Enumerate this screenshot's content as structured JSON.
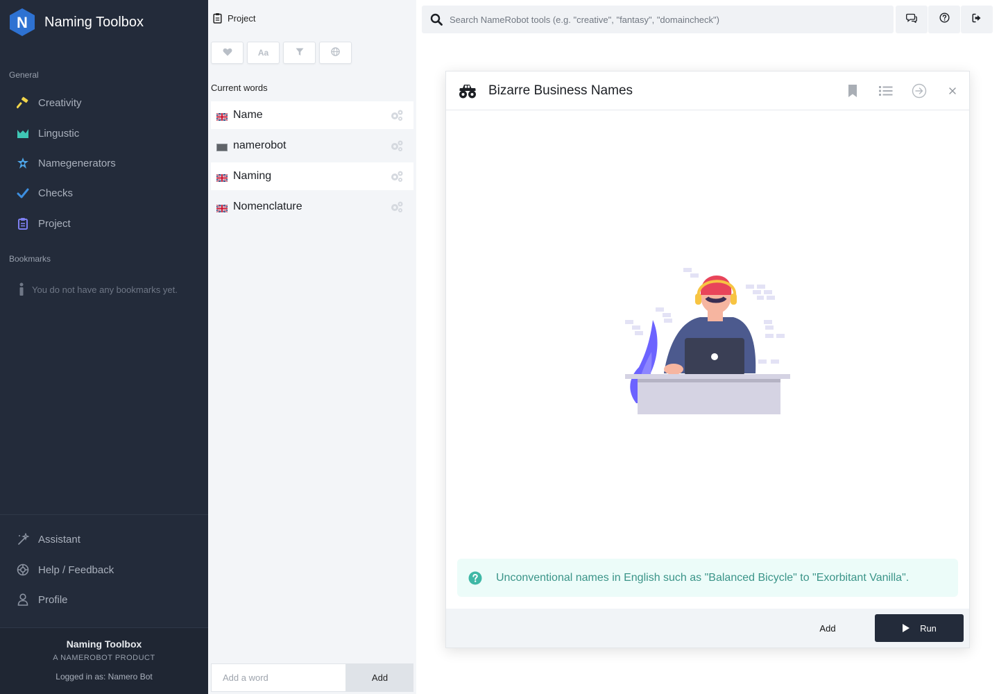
{
  "app": {
    "title": "Naming Toolbox",
    "logo_letter": "N",
    "accent": "#2e72d2"
  },
  "sidebar": {
    "general_label": "General",
    "nav": [
      {
        "label": "Creativity",
        "icon": "hammer-icon",
        "color": "#f0d44a"
      },
      {
        "label": "Lingustic",
        "icon": "chart-icon",
        "color": "#3fc7b5"
      },
      {
        "label": "Namegenerators",
        "icon": "star-badge-icon",
        "color": "#4ea6e8"
      },
      {
        "label": "Checks",
        "icon": "check-icon",
        "color": "#3d8fe0"
      },
      {
        "label": "Project",
        "icon": "clipboard-icon",
        "color": "#7d7ff0"
      }
    ],
    "bookmarks_label": "Bookmarks",
    "bookmarks_empty": "You do not have any bookmarks yet.",
    "bottom_nav": [
      {
        "label": "Assistant",
        "icon": "magic-wand-icon"
      },
      {
        "label": "Help / Feedback",
        "icon": "lifebuoy-icon"
      },
      {
        "label": "Profile",
        "icon": "user-icon"
      }
    ],
    "footer": {
      "title": "Naming Toolbox",
      "subtitle": "A NAMEROBOT PRODUCT",
      "user": "Logged in as: Namero Bot"
    }
  },
  "project": {
    "header": "Project",
    "filters": [
      "heart-icon",
      "font-case-icon",
      "filter-icon",
      "globe-icon"
    ],
    "filter_text": {
      "case": "Aa"
    },
    "current_words_label": "Current words",
    "words": [
      {
        "text": "Name",
        "flag": "uk-flag-icon",
        "active": true
      },
      {
        "text": "namerobot",
        "flag": "generic-flag-icon",
        "active": false
      },
      {
        "text": "Naming",
        "flag": "uk-flag-icon",
        "active": true
      },
      {
        "text": "Nomenclature",
        "flag": "uk-flag-icon",
        "active": false
      }
    ],
    "add_placeholder": "Add a word",
    "add_button": "Add"
  },
  "search": {
    "placeholder": "Search NameRobot tools (e.g. \"creative\", \"fantasy\", \"domaincheck\")"
  },
  "toolbar": [
    "chat-icon",
    "help-circle-icon",
    "logout-icon"
  ],
  "tool": {
    "title": "Bizarre Business Names",
    "icon": "monster-truck-icon",
    "description": "Unconventional names in English such as \"Balanced Bicycle\" to \"Exorbitant Vanilla\".",
    "add_label": "Add",
    "run_label": "Run",
    "info_color": "#3a9488",
    "info_bg": "#ecfcf9"
  }
}
